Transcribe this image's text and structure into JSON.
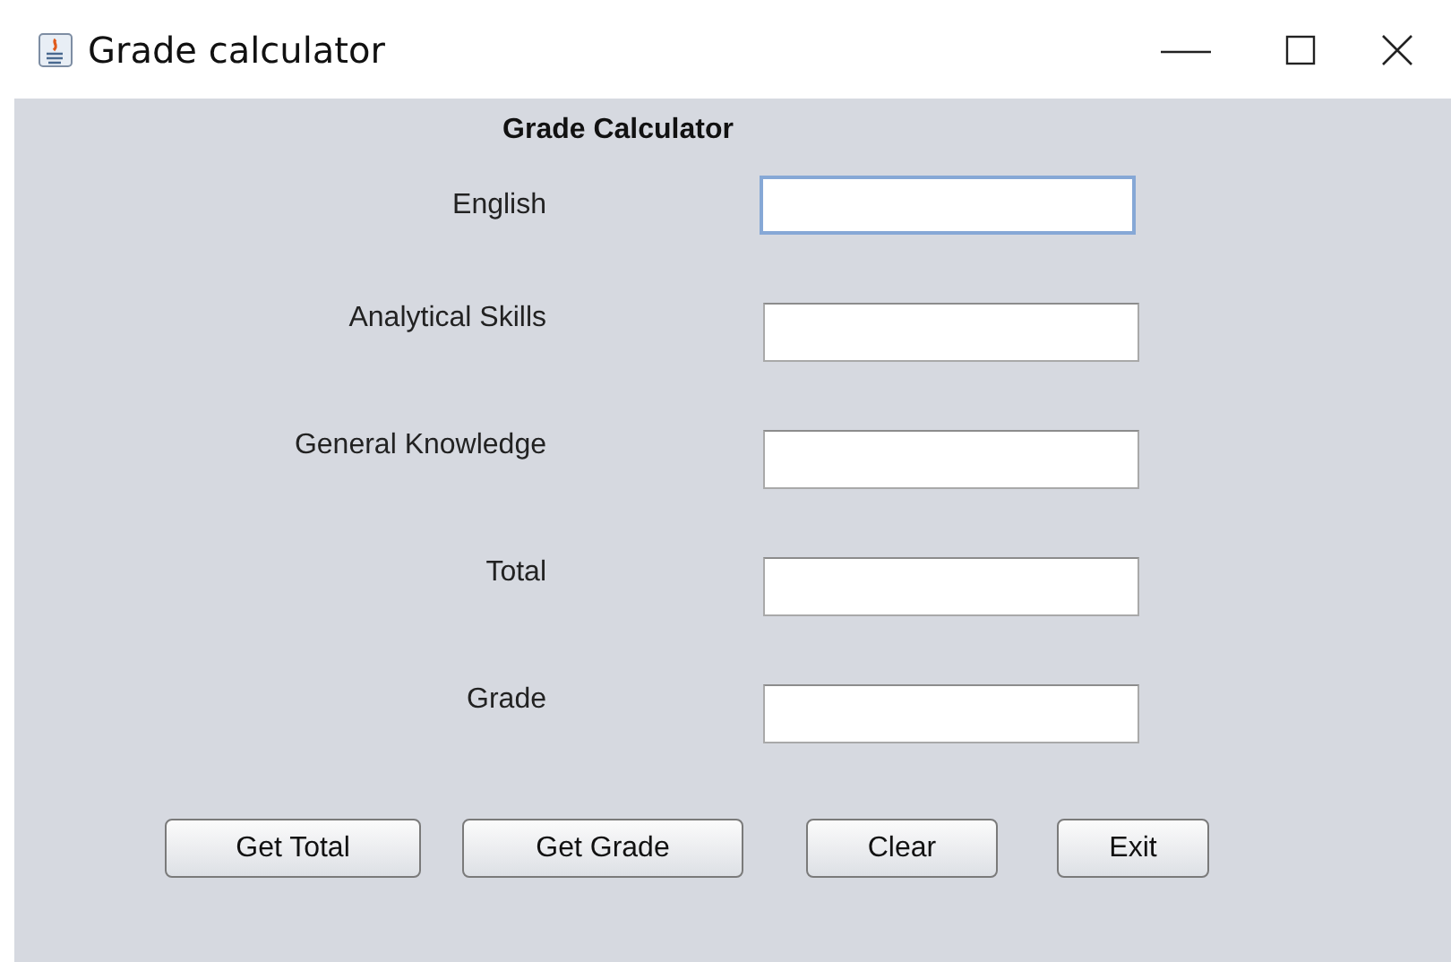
{
  "window": {
    "title": "Grade calculator"
  },
  "heading": "Grade Calculator",
  "fields": [
    {
      "label": "English",
      "focused": true
    },
    {
      "label": "Analytical Skills",
      "focused": false
    },
    {
      "label": "General Knowledge",
      "focused": false
    },
    {
      "label": "Total",
      "focused": false
    },
    {
      "label": "Grade",
      "focused": false
    }
  ],
  "buttons": [
    "Get Total",
    "Get Grade",
    "Clear",
    "Exit"
  ]
}
